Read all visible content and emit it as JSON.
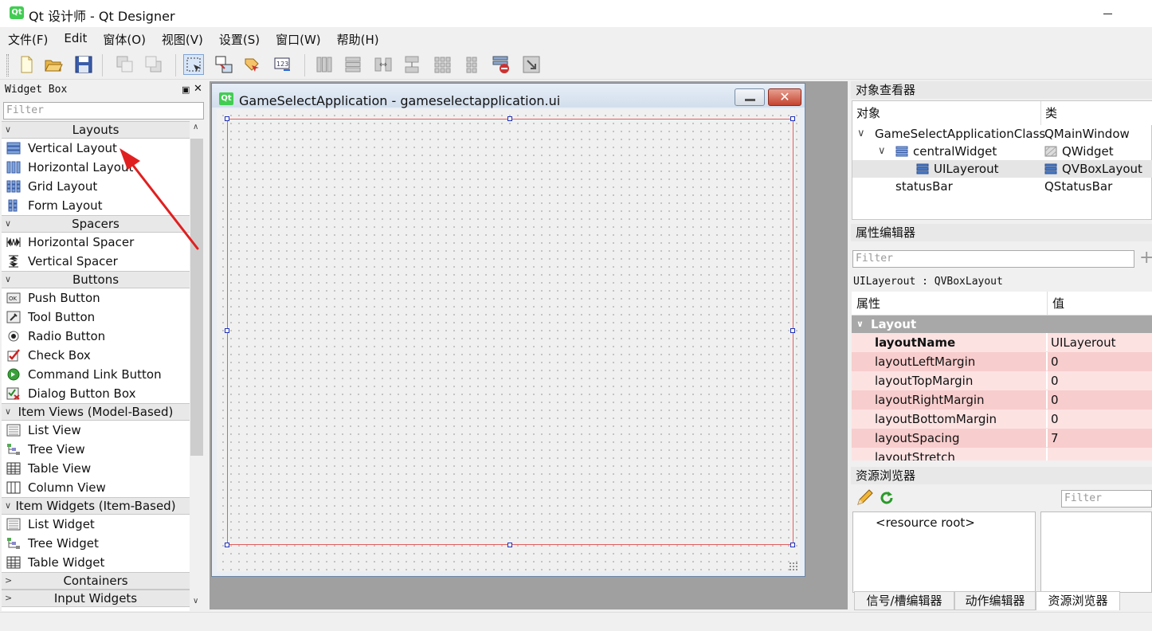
{
  "window": {
    "title": "Qt 设计师 - Qt Designer",
    "icon": "qt-logo-icon"
  },
  "menubar": [
    "文件(F)",
    "Edit",
    "窗体(O)",
    "视图(V)",
    "设置(S)",
    "窗口(W)",
    "帮助(H)"
  ],
  "toolbar": {
    "buttons": [
      "new-file-icon",
      "open-folder-icon",
      "save-icon",
      "send-to-back-icon",
      "bring-to-front-icon",
      "edit-widgets-icon",
      "edit-signals-slots-icon",
      "edit-buddies-icon",
      "edit-tab-order-icon",
      "layout-horizontal-icon",
      "layout-vertical-icon",
      "layout-horizontal-splitter-icon",
      "layout-vertical-splitter-icon",
      "layout-grid-icon",
      "layout-form-icon",
      "break-layout-icon",
      "adjust-size-icon"
    ]
  },
  "widget_box": {
    "title": "Widget Box",
    "filter_placeholder": "Filter",
    "categories": [
      {
        "name": "Layouts",
        "items": [
          "Vertical Layout",
          "Horizontal Layout",
          "Grid Layout",
          "Form Layout"
        ]
      },
      {
        "name": "Spacers",
        "items": [
          "Horizontal Spacer",
          "Vertical Spacer"
        ]
      },
      {
        "name": "Buttons",
        "items": [
          "Push Button",
          "Tool Button",
          "Radio Button",
          "Check Box",
          "Command Link Button",
          "Dialog Button Box"
        ]
      },
      {
        "name": "Item Views (Model-Based)",
        "items": [
          "List View",
          "Tree View",
          "Table View",
          "Column View"
        ]
      },
      {
        "name": "Item Widgets (Item-Based)",
        "items": [
          "List Widget",
          "Tree Widget",
          "Table Widget"
        ]
      },
      {
        "name": "Containers",
        "items": []
      },
      {
        "name": "Input Widgets",
        "items": []
      }
    ]
  },
  "form": {
    "title": "GameSelectApplication - gameselectapplication.ui",
    "icon_text": "Qt",
    "close_glyph": "✕"
  },
  "object_inspector": {
    "title": "对象查看器",
    "columns": [
      "对象",
      "类"
    ],
    "rows": [
      {
        "object": "GameSelectApplicationClass",
        "class": "QMainWindow",
        "expander": "∨",
        "icon": ""
      },
      {
        "object": "centralWidget",
        "class": "QWidget",
        "expander": "∨",
        "icon": "widget-icon"
      },
      {
        "object": "UILayerout",
        "class": "QVBoxLayout",
        "expander": "",
        "icon": "vertical-layout-icon"
      },
      {
        "object": "statusBar",
        "class": "QStatusBar",
        "expander": "",
        "icon": ""
      }
    ]
  },
  "property_editor": {
    "title": "属性编辑器",
    "filter_placeholder": "Filter",
    "add_glyph": "+",
    "object_label": "UILayerout : QVBoxLayout",
    "columns": [
      "属性",
      "值"
    ],
    "group": "Layout",
    "properties": [
      {
        "name": "layoutName",
        "value": "UILayerout",
        "bold": true
      },
      {
        "name": "layoutLeftMargin",
        "value": "0",
        "bold": false
      },
      {
        "name": "layoutTopMargin",
        "value": "0",
        "bold": false
      },
      {
        "name": "layoutRightMargin",
        "value": "0",
        "bold": false
      },
      {
        "name": "layoutBottomMargin",
        "value": "0",
        "bold": false
      },
      {
        "name": "layoutSpacing",
        "value": "7",
        "bold": false
      },
      {
        "name": "layoutStretch",
        "value": "",
        "bold": false
      }
    ]
  },
  "resource_browser": {
    "title": "资源浏览器",
    "filter_placeholder": "Filter",
    "root": "<resource root>"
  },
  "bottom_tabs": [
    "信号/槽编辑器",
    "动作编辑器",
    "资源浏览器"
  ],
  "colors": {
    "selection_red": "#e06060",
    "handle_blue": "#1c2fb8",
    "property_pink": "#fde2e2",
    "property_pink_dark": "#f8cdcd",
    "arrow_red": "#e02020"
  }
}
